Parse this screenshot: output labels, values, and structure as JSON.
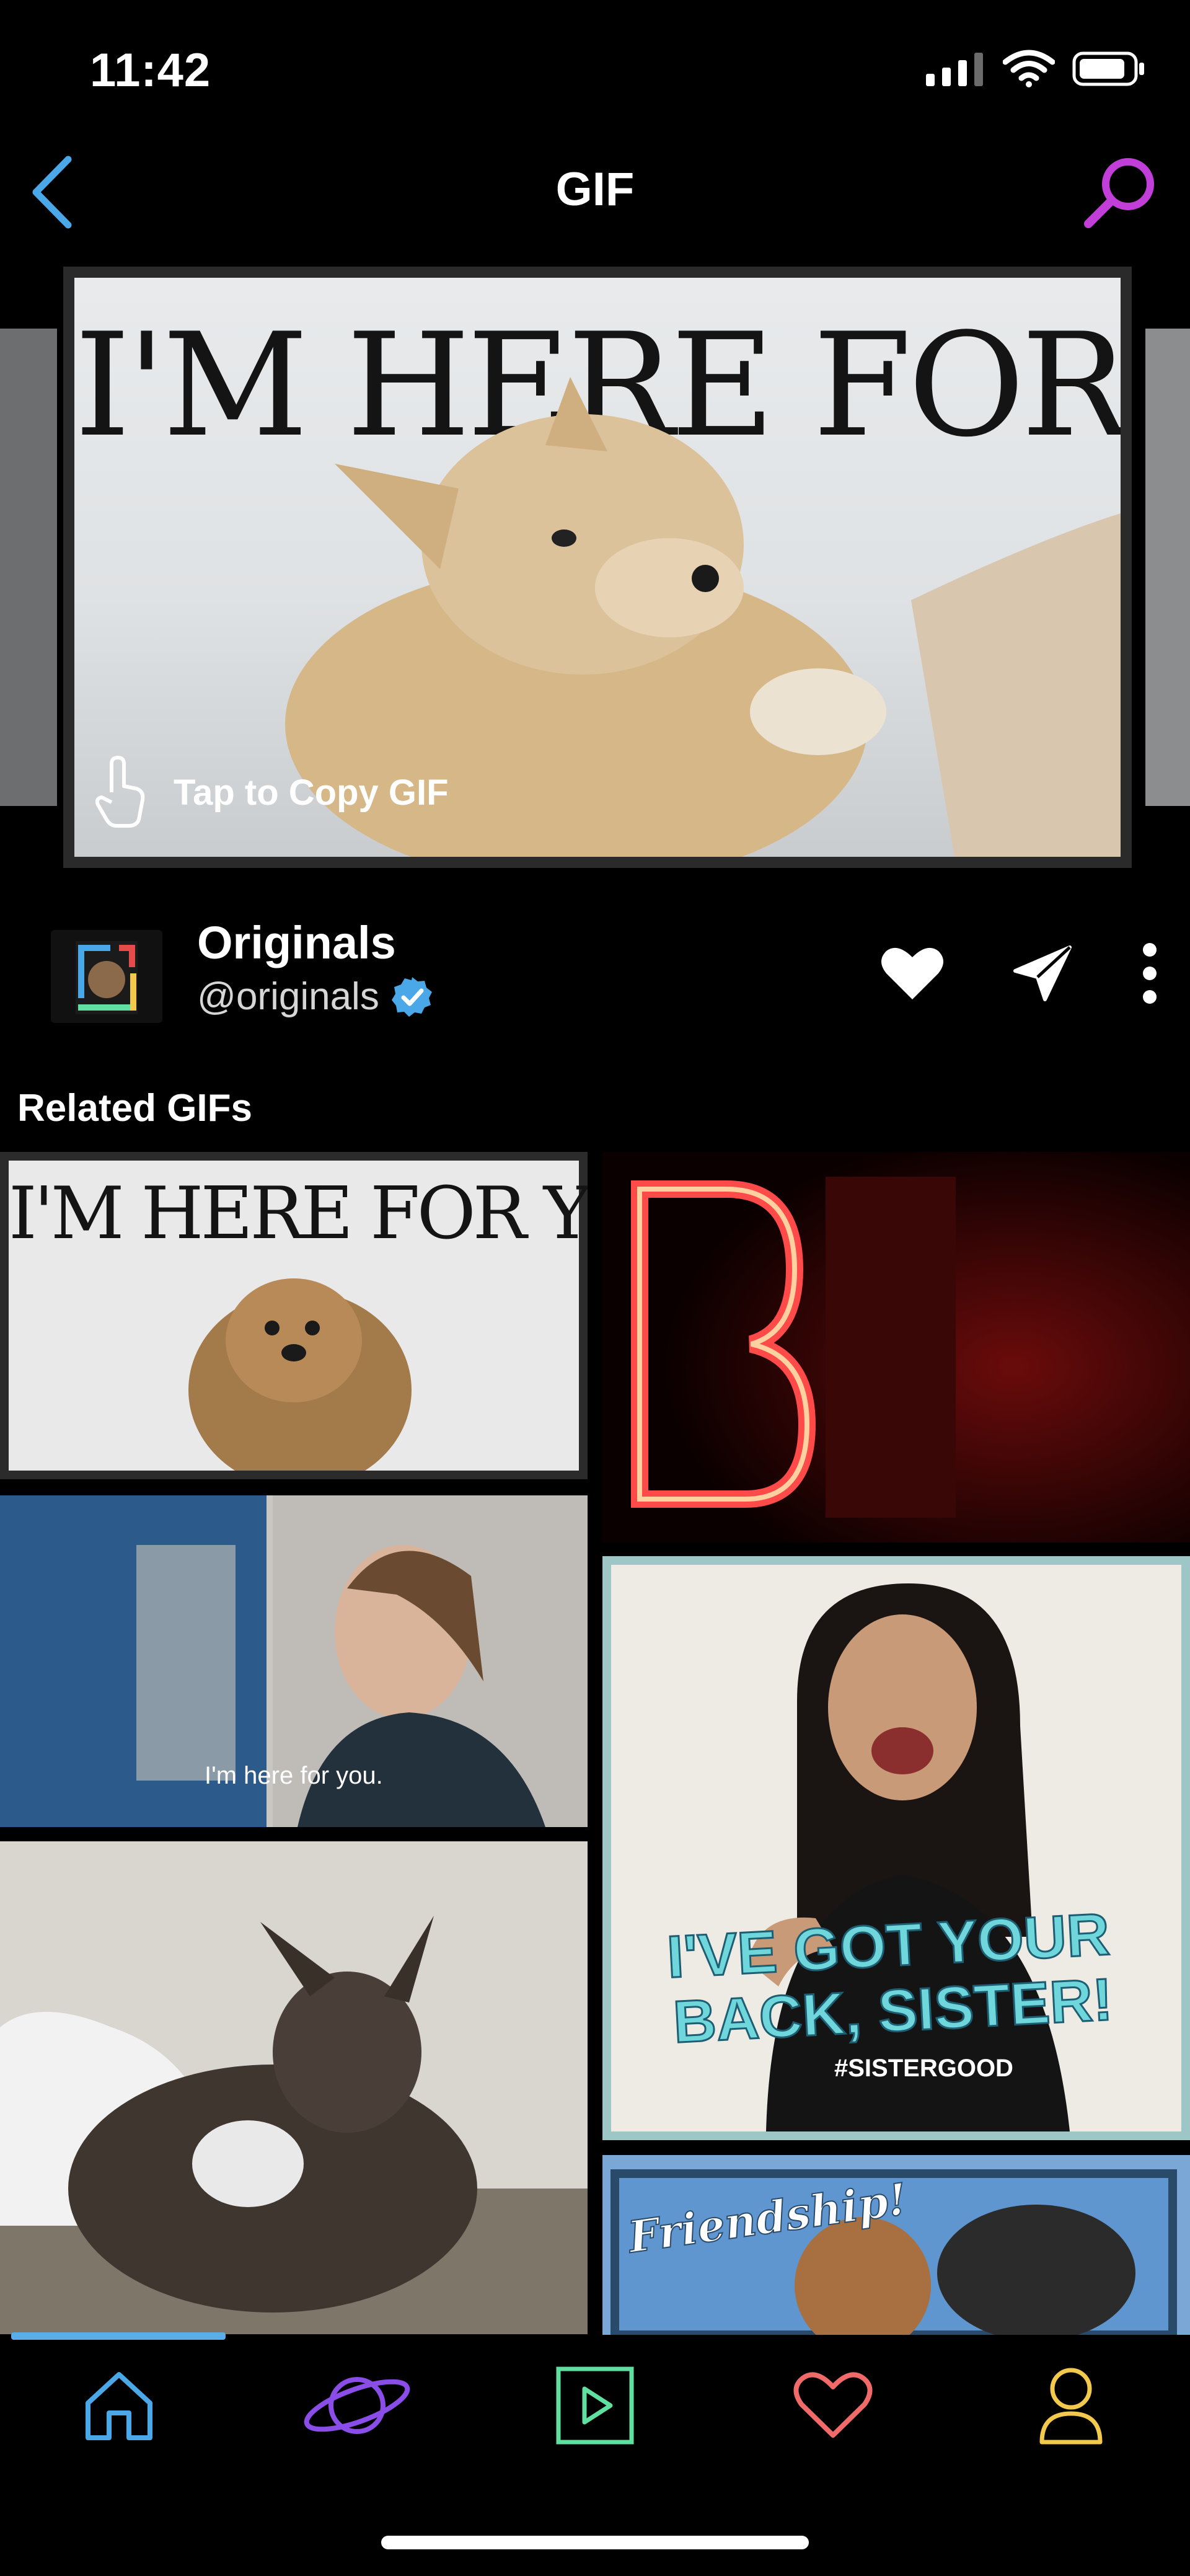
{
  "status_bar": {
    "time": "11:42"
  },
  "header": {
    "title": "GIF"
  },
  "main_gif": {
    "caption": "I'M HERE FOR YOU",
    "copy_hint": "Tap to Copy GIF"
  },
  "user": {
    "name": "Originals",
    "handle": "@originals"
  },
  "related": {
    "title": "Related GIFs",
    "items": [
      {
        "caption": "I'M HERE FOR YOU"
      },
      {
        "caption": "B"
      },
      {
        "caption": "I'm here for you."
      },
      {
        "caption_line1": "I'VE GOT YOUR",
        "caption_line2": "BACK, SISTER!",
        "tag": "#SISTERGOOD"
      },
      {
        "caption": ""
      },
      {
        "caption": "Friendship!"
      }
    ]
  },
  "nav": {
    "items": [
      {
        "icon": "home-icon",
        "color": "#4aa8e8"
      },
      {
        "icon": "planet-icon",
        "color": "#8a4de8"
      },
      {
        "icon": "play-icon",
        "color": "#5fe0a0"
      },
      {
        "icon": "heart-icon",
        "color": "#f06a6a"
      },
      {
        "icon": "profile-icon",
        "color": "#f2c94c"
      }
    ]
  },
  "colors": {
    "accent_back": "#4aa8e8",
    "accent_search": "#c13fd8",
    "verified": "#4aa8e8"
  }
}
